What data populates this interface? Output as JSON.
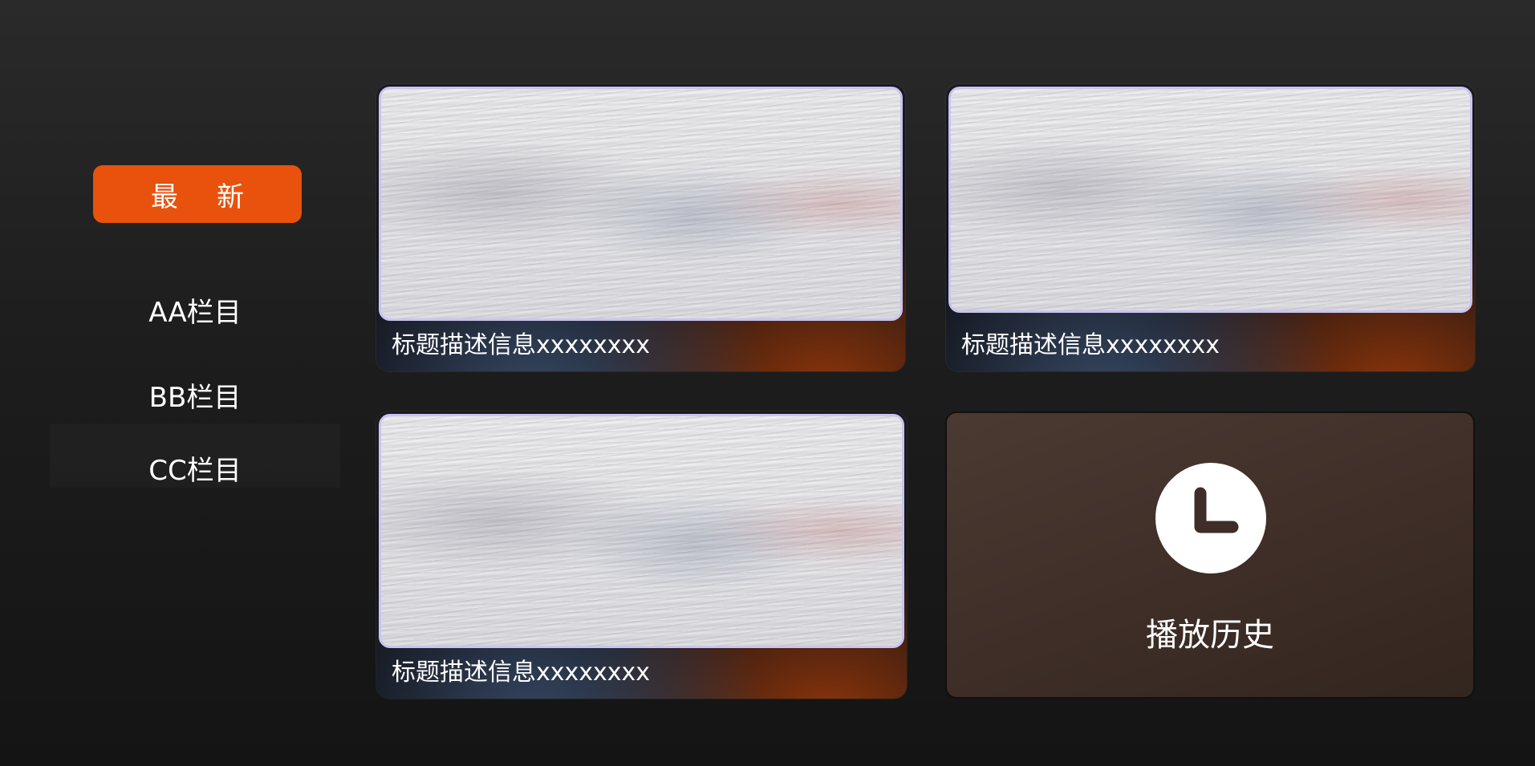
{
  "sidebar": {
    "active_label": "最新",
    "items": [
      {
        "label": "AA栏目"
      },
      {
        "label": "BB栏目"
      },
      {
        "label": "CC栏目"
      }
    ]
  },
  "grid": {
    "cards": [
      {
        "caption": "标题描述信息xxxxxxxx"
      },
      {
        "caption": "标题描述信息xxxxxxxx"
      },
      {
        "caption": "标题描述信息xxxxxxxx"
      }
    ],
    "history": {
      "label": "播放历史",
      "icon": "clock-icon"
    }
  },
  "colors": {
    "accent": "#e8520c",
    "thumb_border": "#c9c4ee",
    "history_bg": "#3e2e27"
  }
}
